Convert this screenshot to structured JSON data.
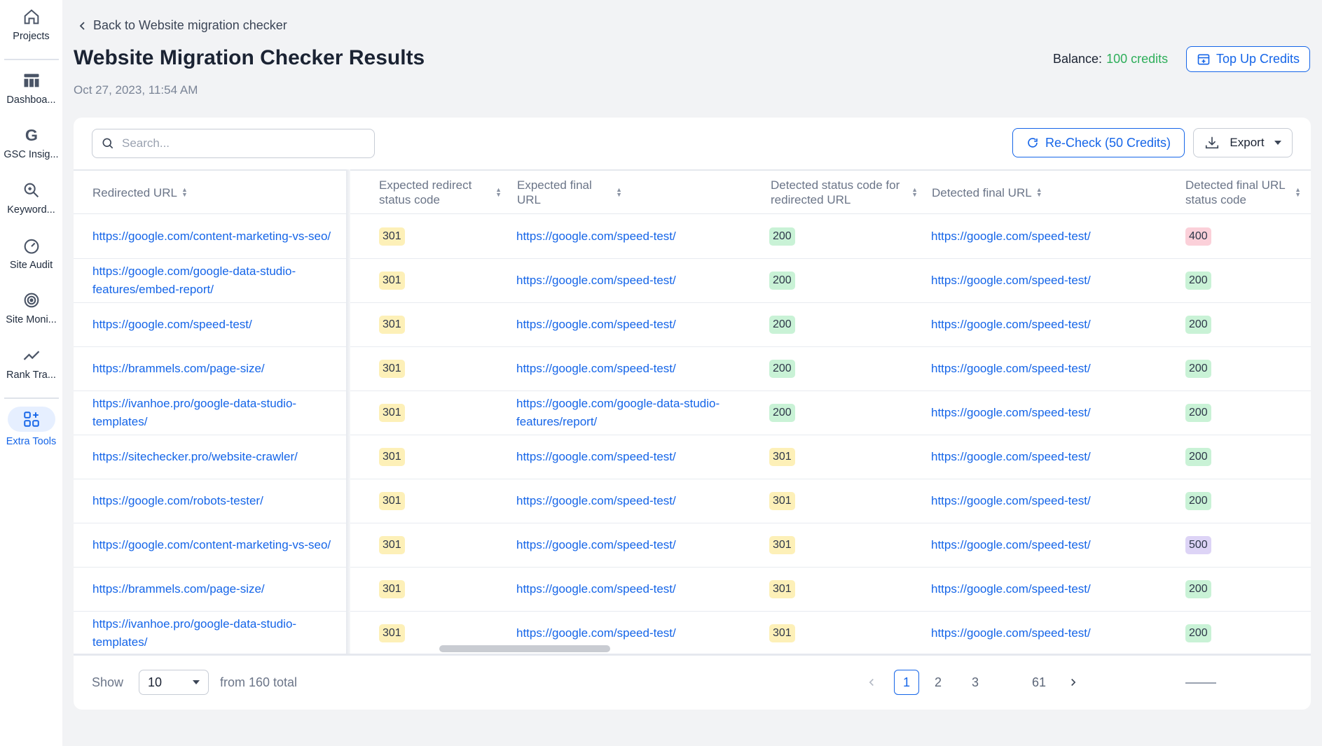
{
  "sidebar": {
    "items": [
      {
        "label": "Projects",
        "icon": "home-icon"
      },
      {
        "label": "Dashboa...",
        "icon": "dashboard-icon"
      },
      {
        "label": "GSC Insig...",
        "icon": "google-icon"
      },
      {
        "label": "Keyword...",
        "icon": "keyword-search-icon"
      },
      {
        "label": "Site Audit",
        "icon": "gauge-icon"
      },
      {
        "label": "Site Moni...",
        "icon": "monitor-radar-icon"
      },
      {
        "label": "Rank Tra...",
        "icon": "trend-line-icon"
      },
      {
        "label": "Extra Tools",
        "icon": "extra-tools-icon"
      }
    ]
  },
  "header": {
    "back_label": "Back to Website migration checker",
    "title": "Website Migration Checker Results",
    "date": "Oct 27, 2023, 11:54 AM",
    "balance_label": "Balance:",
    "balance_value": "100 credits",
    "topup_label": "Top Up Credits"
  },
  "toolbar": {
    "search_placeholder": "Search...",
    "recheck_label": "Re-Check (50 Credits)",
    "export_label": "Export"
  },
  "table": {
    "columns": [
      "Redirected URL",
      "Expected redirect status code",
      "Expected final URL",
      "Detected status code for redirected URL",
      "Detected final URL",
      "Detected final URL status code"
    ],
    "rows": [
      [
        "https://google.com/content-marketing-vs-seo/",
        "301",
        "https://google.com/speed-test/",
        "200",
        "https://google.com/speed-test/",
        "400"
      ],
      [
        "https://google.com/google-data-studio-features/embed-report/",
        "301",
        "https://google.com/speed-test/",
        "200",
        "https://google.com/speed-test/",
        "200"
      ],
      [
        "https://google.com/speed-test/",
        "301",
        "https://google.com/speed-test/",
        "200",
        "https://google.com/speed-test/",
        "200"
      ],
      [
        "https://brammels.com/page-size/",
        "301",
        "https://google.com/speed-test/",
        "200",
        "https://google.com/speed-test/",
        "200"
      ],
      [
        "https://ivanhoe.pro/google-data-studio-templates/",
        "301",
        "https://google.com/google-data-studio-features/report/",
        "200",
        "https://google.com/speed-test/",
        "200"
      ],
      [
        "https://sitechecker.pro/website-crawler/",
        "301",
        "https://google.com/speed-test/",
        "301",
        "https://google.com/speed-test/",
        "200"
      ],
      [
        "https://google.com/robots-tester/",
        "301",
        "https://google.com/speed-test/",
        "301",
        "https://google.com/speed-test/",
        "200"
      ],
      [
        "https://google.com/content-marketing-vs-seo/",
        "301",
        "https://google.com/speed-test/",
        "301",
        "https://google.com/speed-test/",
        "500"
      ],
      [
        "https://brammels.com/page-size/",
        "301",
        "https://google.com/speed-test/",
        "301",
        "https://google.com/speed-test/",
        "200"
      ],
      [
        "https://ivanhoe.pro/google-data-studio-templates/",
        "301",
        "https://google.com/speed-test/",
        "301",
        "https://google.com/speed-test/",
        "200"
      ]
    ]
  },
  "footer": {
    "show_label": "Show",
    "per_page": "10",
    "total_label": "from 160 total",
    "pages": [
      "1",
      "2",
      "3",
      "61"
    ],
    "current_page": "1"
  },
  "colors": {
    "accent": "#1565e8",
    "credits_green": "#2eae5a",
    "badge_301": "#fdf0b8",
    "badge_200": "#c9f2d6",
    "badge_400": "#fbd0d9",
    "badge_500": "#ddd4f6"
  }
}
